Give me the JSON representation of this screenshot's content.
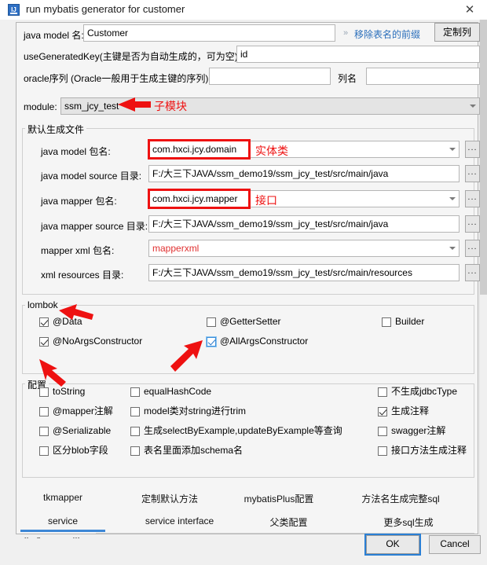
{
  "window": {
    "title": "run mybatis generator for customer",
    "icon": "intellij-idea-icon",
    "close_label": "✕"
  },
  "top_fields": {
    "model_name_label": "java model 名:",
    "model_name_value": "Customer",
    "remove_prefix_link": "移除表名的前缀",
    "chevron": "»",
    "custom_columns_button": "定制列",
    "use_generated_key_label": "useGeneratedKey(主键是否为自动生成的，可为空):",
    "use_generated_key_value": "id",
    "oracle_seq_label": "oracle序列 (Oracle一般用于生成主键的序列)",
    "oracle_seq_value": "",
    "column_name_label": "列名",
    "column_name_value": ""
  },
  "module": {
    "label": "module:",
    "value": "ssm_jcy_test"
  },
  "generated_files": {
    "group_title": "默认生成文件",
    "rows": [
      {
        "label": "java model 包名:",
        "value": "com.hxci.jcy.domain",
        "type": "combo",
        "browse": "..."
      },
      {
        "label": "java model source 目录:",
        "value": "F:/大三下JAVA/ssm_demo19/ssm_jcy_test/src/main/java",
        "type": "text",
        "browse": "..."
      },
      {
        "label": "java mapper 包名:",
        "value": "com.hxci.jcy.mapper",
        "type": "combo",
        "browse": "..."
      },
      {
        "label": "java mapper source 目录:",
        "value": "F:/大三下JAVA/ssm_demo19/ssm_jcy_test/src/main/java",
        "type": "text",
        "browse": "..."
      },
      {
        "label": "mapper xml 包名:",
        "value": "mapperxml",
        "type": "combo",
        "browse": "..."
      },
      {
        "label": "xml resources 目录:",
        "value": "F:/大三下JAVA/ssm_demo19/ssm_jcy_test/src/main/resources",
        "type": "text",
        "browse": "..."
      }
    ]
  },
  "lombok": {
    "group_title": "lombok",
    "items": [
      {
        "label": "@Data",
        "checked": true,
        "focused": false
      },
      {
        "label": "@GetterSetter",
        "checked": false,
        "focused": false
      },
      {
        "label": "Builder",
        "checked": false,
        "focused": false
      },
      {
        "label": "@NoArgsConstructor",
        "checked": true,
        "focused": false
      },
      {
        "label": "@AllArgsConstructor",
        "checked": true,
        "focused": true
      }
    ]
  },
  "config": {
    "group_title": "配置",
    "items": [
      {
        "label": "toString",
        "checked": false
      },
      {
        "label": "equalHashCode",
        "checked": false
      },
      {
        "label": "不生成jdbcType",
        "checked": false
      },
      {
        "label": "@mapper注解",
        "checked": false
      },
      {
        "label": "model类对string进行trim",
        "checked": false
      },
      {
        "label": "生成注释",
        "checked": true
      },
      {
        "label": "@Serializable",
        "checked": false
      },
      {
        "label": "生成selectByExample,updateByExample等查询",
        "checked": false
      },
      {
        "label": "swagger注解",
        "checked": false
      },
      {
        "label": "区分blob字段",
        "checked": false
      },
      {
        "label": "表名里面添加schema名",
        "checked": false
      },
      {
        "label": "接口方法生成注释",
        "checked": false
      }
    ]
  },
  "tabs": {
    "row1": [
      {
        "label": "tkmapper",
        "active": false
      },
      {
        "label": "定制默认方法",
        "active": false
      },
      {
        "label": "mybatisPlus配置",
        "active": false
      },
      {
        "label": "方法名生成完整sql",
        "active": false
      }
    ],
    "row2": [
      {
        "label": "service",
        "active": true
      },
      {
        "label": "service interface",
        "active": false
      },
      {
        "label": "父类配置",
        "active": false
      },
      {
        "label": "更多sql生成",
        "active": false
      }
    ]
  },
  "service_group": {
    "title": "生成service类"
  },
  "footer": {
    "ok_label": "OK",
    "cancel_label": "Cancel"
  },
  "annotations": {
    "module_note": "子模块",
    "model_package_note": "实体类",
    "mapper_package_note": "接口",
    "accent_color": "#ee1111"
  }
}
